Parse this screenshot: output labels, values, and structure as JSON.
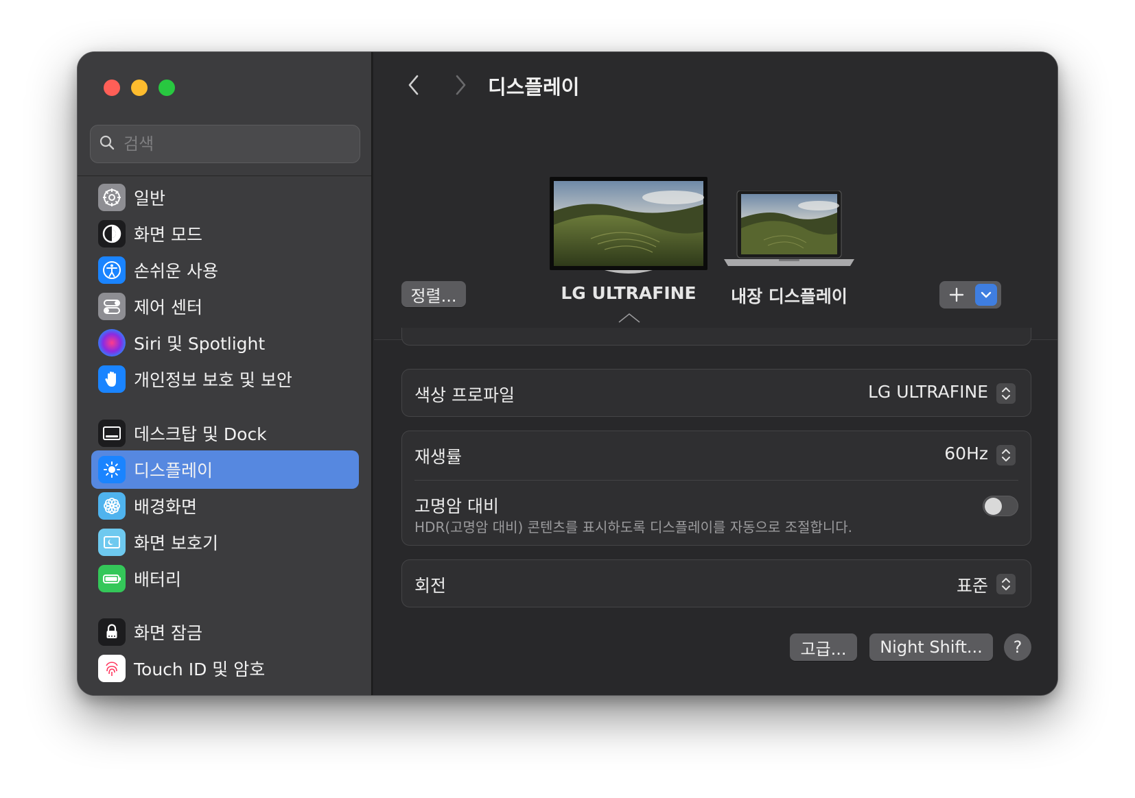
{
  "window": {
    "title": "디스플레이"
  },
  "sidebar": {
    "search_placeholder": "검색",
    "items": [
      {
        "label": "일반",
        "icon": "gear-icon"
      },
      {
        "label": "화면 모드",
        "icon": "appearance-icon"
      },
      {
        "label": "손쉬운 사용",
        "icon": "accessibility-icon"
      },
      {
        "label": "제어 센터",
        "icon": "control-center-icon"
      },
      {
        "label": "Siri 및 Spotlight",
        "icon": "siri-icon"
      },
      {
        "label": "개인정보 보호 및 보안",
        "icon": "hand-icon"
      },
      {
        "label": "데스크탑 및 Dock",
        "icon": "dock-icon"
      },
      {
        "label": "디스플레이",
        "icon": "sun-icon",
        "selected": true
      },
      {
        "label": "배경화면",
        "icon": "flower-icon"
      },
      {
        "label": "화면 보호기",
        "icon": "screensaver-icon"
      },
      {
        "label": "배터리",
        "icon": "battery-icon"
      },
      {
        "label": "화면 잠금",
        "icon": "lock-icon"
      },
      {
        "label": "Touch ID 및 암호",
        "icon": "fingerprint-icon"
      }
    ]
  },
  "header": {
    "title": "디스플레이",
    "arrange_button": "정렬...",
    "displays": [
      {
        "name": "LG ULTRAFINE",
        "selected": true
      },
      {
        "name": "내장 디스플레이",
        "selected": false
      }
    ]
  },
  "settings": {
    "color_profile": {
      "label": "색상 프로파일",
      "value": "LG ULTRAFINE"
    },
    "refresh_rate": {
      "label": "재생률",
      "value": "60Hz"
    },
    "hdr": {
      "label": "고명암 대비",
      "description": "HDR(고명암 대비) 콘텐츠를 표시하도록 디스플레이를 자동으로 조절합니다.",
      "enabled": false
    },
    "rotation": {
      "label": "회전",
      "value": "표준"
    }
  },
  "footer": {
    "advanced_button": "고급...",
    "night_shift_button": "Night Shift...",
    "help_button": "?"
  },
  "colors": {
    "accent": "#5688e0",
    "sidebar_bg": "#3c3c3e",
    "main_bg": "#28282a"
  }
}
